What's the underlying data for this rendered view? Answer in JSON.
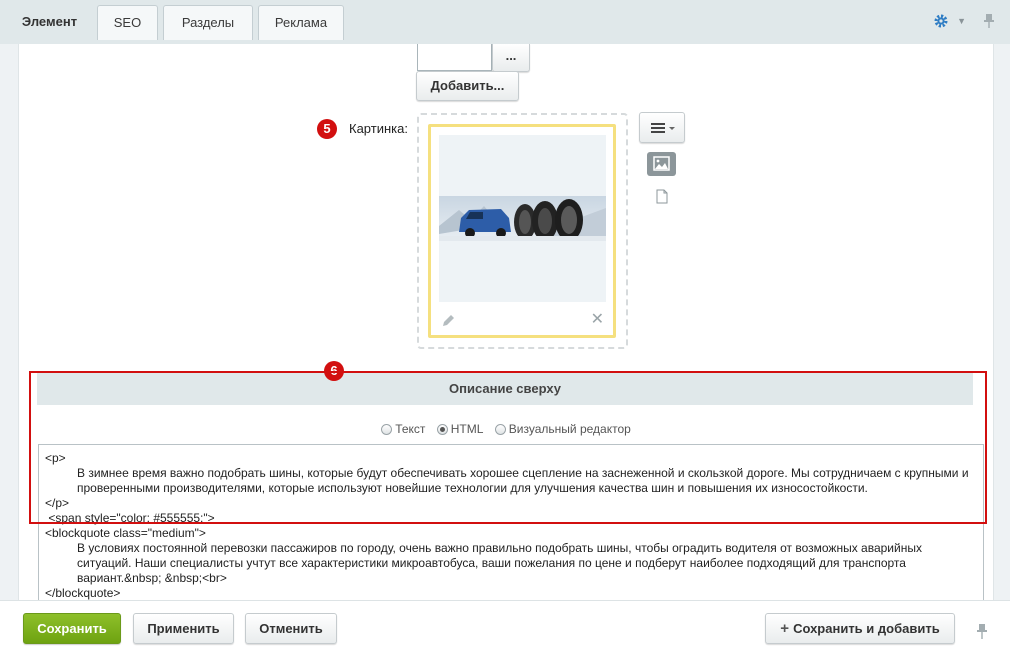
{
  "tabs": [
    {
      "label": "Элемент",
      "active": true
    },
    {
      "label": "SEO"
    },
    {
      "label": "Разделы"
    },
    {
      "label": "Реклама"
    }
  ],
  "file_field": {
    "browse_label": "...",
    "add_label": "Добавить..."
  },
  "image_field": {
    "marker": "5",
    "label": "Картинка:"
  },
  "section": {
    "marker": "6",
    "title": "Описание сверху",
    "mode_options": [
      {
        "label": "Текст",
        "checked": false
      },
      {
        "label": "HTML",
        "checked": true
      },
      {
        "label": "Визуальный редактор",
        "checked": false
      }
    ],
    "code_lines": [
      "<p>",
      "В зимнее время важно подобрать шины, которые будут обеспечивать хорошее сцепление на заснеженной и скользкой дороге. Мы сотрудничаем с крупными и проверенными производителями, которые используют новейшие технологии для улучшения качества шин и повышения их износостойкости.",
      "</p>",
      " <span style=\"color: #555555;\">",
      "<blockquote class=\"medium\">",
      "В условиях постоянной перевозки пассажиров по городу, очень важно правильно подобрать шины, чтобы оградить водителя от возможных аварийных ситуаций. Наши специалисты учтут все характеристики микроавтобуса, ваши пожелания по цене и подберут наиболее подходящий для транспорта вариант.&nbsp; &nbsp;<br>",
      "</blockquote>"
    ]
  },
  "footer": {
    "save": "Сохранить",
    "apply": "Применить",
    "cancel": "Отменить",
    "save_and_add": "Сохранить и добавить"
  },
  "colors": {
    "accent_green": "#7cb21a",
    "marker_red": "#d20f0f",
    "highlight_border": "#d20f0f",
    "preview_border": "#f5e07f"
  }
}
